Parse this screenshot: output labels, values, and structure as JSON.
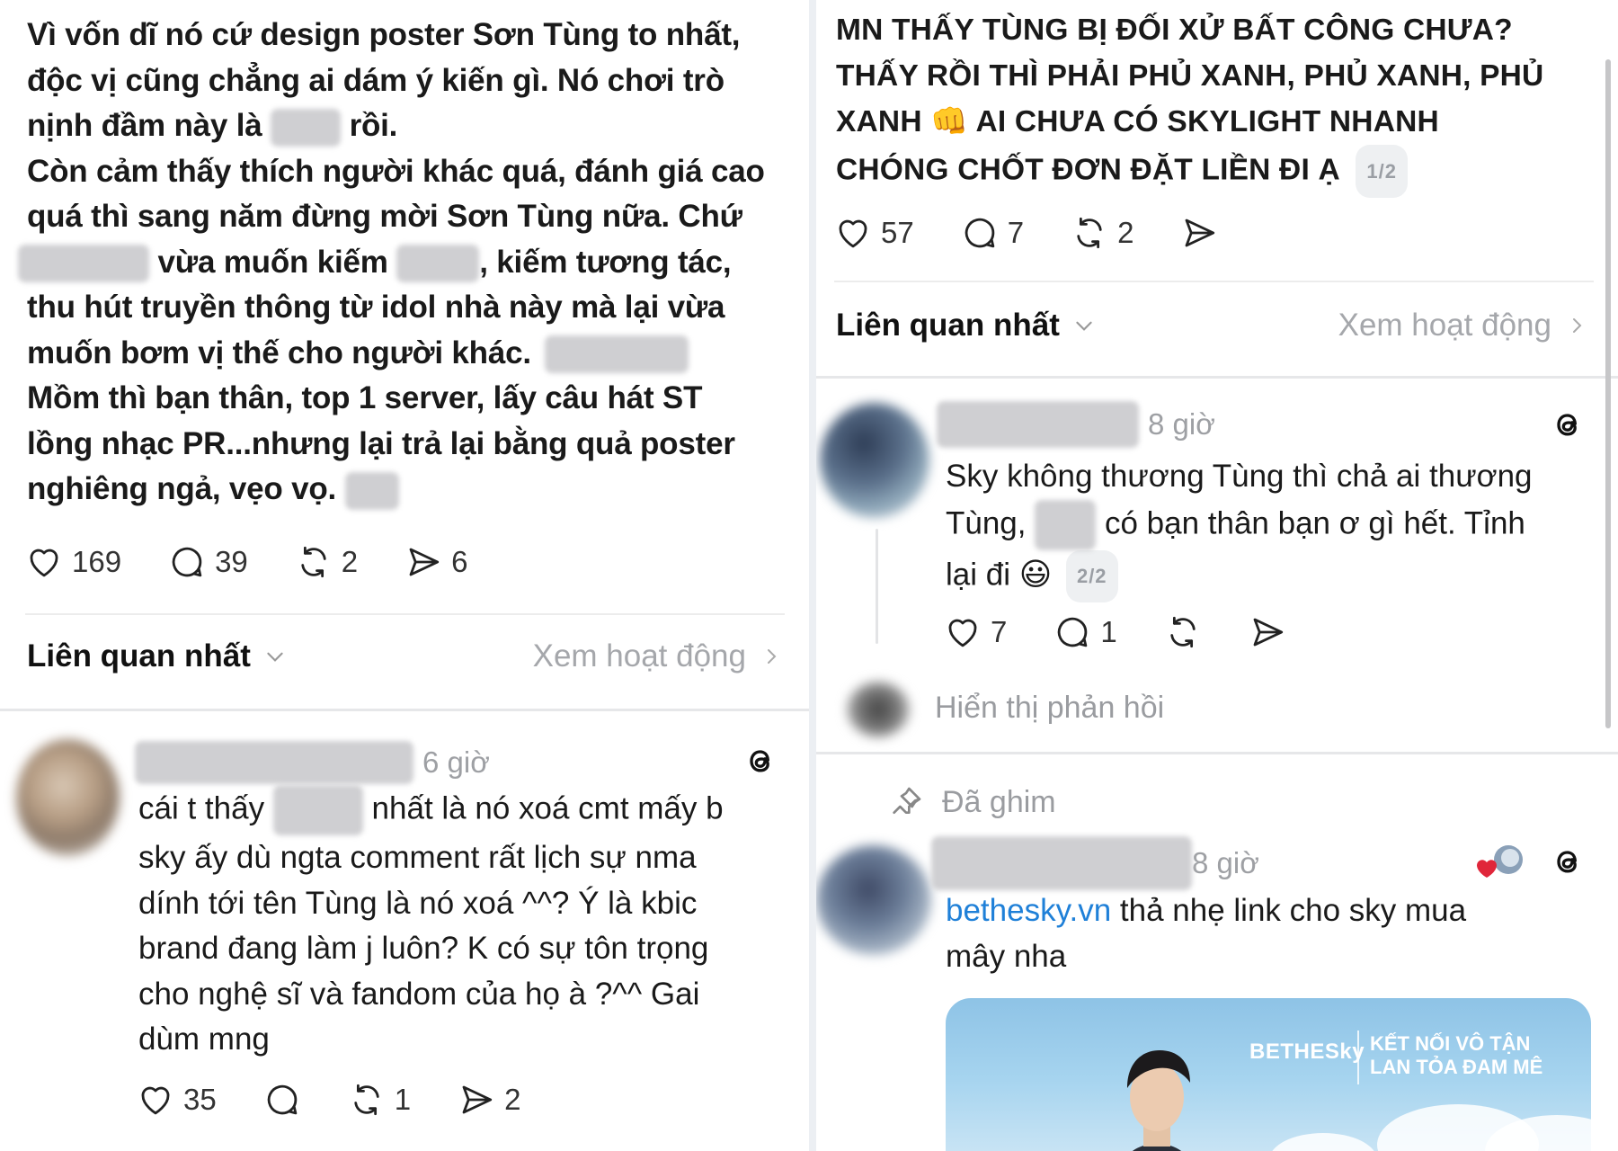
{
  "left_post": {
    "lines": [
      "Vì vốn dĩ nó cứ design poster Sơn Tùng to nhất,",
      "độc vị cũng chẳng ai dám ý kiến gì. Nó chơi trò",
      "nịnh đầm này là",
      "rồi.",
      "Còn cảm thấy thích người khác quá, đánh giá cao",
      "quá thì sang năm đừng mời Sơn Tùng nữa. Chứ",
      "vừa muốn kiếm",
      ", kiếm tương tác,",
      "thu hút truyền thông từ idol nhà này mà lại vừa",
      "muốn bơm vị thế cho người khác.",
      "Mồm thì bạn thân, top 1 server, lấy câu hát ST",
      "lồng nhạc PR...nhưng lại trả lại bằng quả poster",
      "nghiêng ngả, vẹo vọ."
    ],
    "likes": "169",
    "comments": "39",
    "reposts": "2",
    "shares": "6"
  },
  "left_sort": {
    "title": "Liên quan nhất",
    "activity": "Xem hoạt động"
  },
  "left_comment": {
    "time": "6 giờ",
    "lines": [
      "cái t thấy",
      "nhất là nó xoá cmt mấy b",
      "sky ấy dù ngta comment rất lịch sự nma",
      "dính tới tên Tùng là nó xoá ^^? Ý là kbic",
      "brand đang làm j luôn? K có sự tôn trọng",
      "cho nghệ sĩ và fandom của họ à ?^^ Gai",
      "dùm mng"
    ],
    "likes": "35",
    "reposts": "1",
    "shares": "2"
  },
  "right_post": {
    "lines": [
      "MN THẤY TÙNG BỊ ĐỐI XỬ BẤT CÔNG CHƯA?",
      "THẤY RỒI THÌ PHẢI PHỦ XANH, PHỦ XANH, PHỦ",
      "XANH",
      "AI CHƯA CÓ SKYLIGHT NHANH",
      "CHÓNG CHỐT ĐƠN ĐẶT LIỀN ĐI Ạ"
    ],
    "emoji": "👊",
    "page_chip": "1/2",
    "likes": "57",
    "comments": "7",
    "reposts": "2"
  },
  "right_sort": {
    "title": "Liên quan nhất",
    "activity": "Xem hoạt động"
  },
  "right_comment": {
    "time": "8 giờ",
    "lines": [
      "Sky không thương Tùng thì chả ai thương",
      "Tùng,",
      "có bạn thân bạn ơ gì hết. Tỉnh",
      "lại đi"
    ],
    "emoji": "😃",
    "page_chip": "2/2",
    "likes": "7",
    "comments": "1",
    "show_replies": "Hiển thị phản hồi"
  },
  "pinned": {
    "label": "Đã ghim",
    "time": "8 giờ",
    "link": "bethesky.vn",
    "text_after_link": " thả nhẹ link cho sky mua",
    "line2": "mây nha",
    "banner_brand": "BETHESky",
    "banner_line1": "KẾT NỐI VÔ TẬN",
    "banner_line2": "LAN TỎA ĐAM MÊ"
  },
  "colors": {
    "link": "#1f80d8",
    "muted": "#9ea0a4",
    "chip_bg": "#eef0f2",
    "text": "#1a1a1a"
  }
}
